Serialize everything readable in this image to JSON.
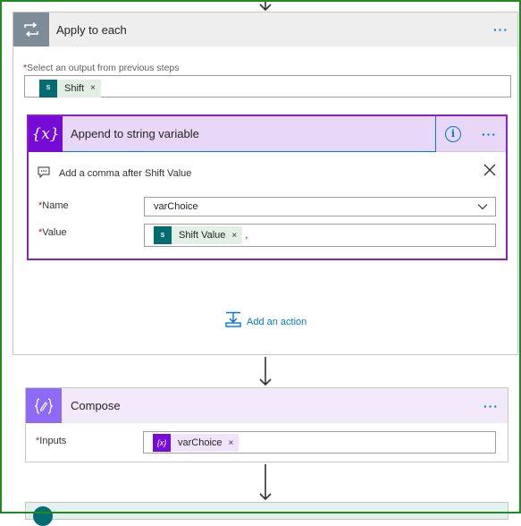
{
  "apply_each": {
    "title": "Apply to each",
    "more": "···",
    "select_label": "Select an output from previous steps",
    "required_mark": "*",
    "token": "Shift",
    "token_remove": "×"
  },
  "append": {
    "icon_text": "{x}",
    "title": "Append to string variable",
    "info": "i",
    "more": "···",
    "note": "Add a comma after Shift Value",
    "name_label": "Name",
    "name_value": "varChoice",
    "value_label": "Value",
    "value_token": "Shift Value",
    "value_token_remove": "×",
    "value_suffix": ","
  },
  "add_action": {
    "label": "Add an action"
  },
  "compose": {
    "title": "Compose",
    "more": "···",
    "inputs_label": "Inputs",
    "token": "varChoice",
    "token_remove": "×",
    "token_icon_text": "{x}"
  },
  "icons": {
    "loop": "loop-icon",
    "sharepoint": "sharepoint-icon",
    "variable": "variable-icon",
    "comment": "comment-icon",
    "close": "close-icon",
    "chevron": "chevron-down-icon",
    "compose": "compose-icon",
    "add_action": "add-action-icon",
    "arrow": "arrow-down-icon"
  },
  "colors": {
    "accent": "#0078d4",
    "variable_purple": "#770bd6",
    "compose_purple": "#8f6bf5",
    "loop_gray": "#7e8c97",
    "sharepoint_teal": "#036c70",
    "required_red": "#a4262c",
    "frame_green": "#1f8a1f"
  }
}
